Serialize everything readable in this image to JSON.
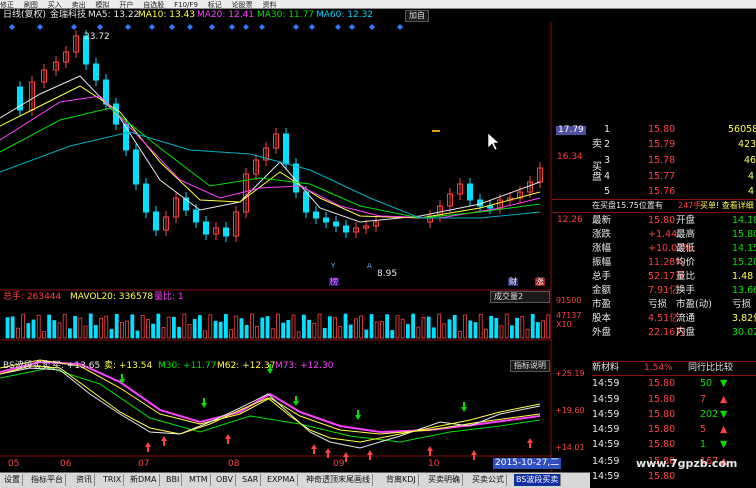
{
  "toolbar": {
    "items": [
      "修正",
      "刷图",
      "买入",
      "卖出",
      "模拟",
      "开户",
      "自选股",
      "F10/F9",
      "标记",
      "论股票",
      "资料"
    ]
  },
  "header": {
    "period": "日线(复权)",
    "stock": "金瑞科技",
    "ma5": "MA5: 13.22",
    "ma10": "MA10: 13.43",
    "ma20": "MA20: 12.41",
    "ma30": "MA30: 11.77",
    "ma60": "MA60: 12.32",
    "add_button": "加自"
  },
  "price_axis": {
    "p1": "17.79",
    "p2": "16.34",
    "p3": "12.26"
  },
  "annotations": {
    "high": "23.72",
    "low": "8.95",
    "hot_mark": "榜",
    "cai": "财",
    "zhang": "涨",
    "y_mark": "Y",
    "a_mark": "A"
  },
  "volume": {
    "label": "总手: 263444",
    "ma20": "MAVOL20: 336578",
    "ratio_label": "量比: 1",
    "dropdown": "成交量2",
    "axis_top": "91500",
    "axis_mid": "47137",
    "axis_unit": "X10"
  },
  "indicator": {
    "name": "BS波段买卖",
    "buy": "买: +13.65",
    "sell": "卖: +13.54",
    "m30": "M30: +11.77",
    "m62": "M62: +12.37",
    "m73": "M73: +12.30",
    "help_button": "指标说明",
    "axis1": "+25.19",
    "axis2": "+19.60",
    "axis3": "+14.01"
  },
  "x_axis": {
    "labels": [
      "05",
      "06",
      "07",
      "08",
      "09",
      "10"
    ],
    "date_badge": "2015-10-27,二"
  },
  "bottom_tabs": [
    "设置",
    "指标平台",
    "资讯",
    "TRIX",
    "新DMA",
    "BBI",
    "MTM",
    "OBV",
    "SAR",
    "EXPMA",
    "神奇透顶末尾画线",
    "背离KDJ",
    "买卖明确",
    "买卖公式",
    "BS波段买卖"
  ],
  "order_book": {
    "top_price": "17.79",
    "sell_side_label": "卖",
    "buy_side_label": "买盘",
    "rows": [
      {
        "idx": "1",
        "price": "15.80",
        "vol": "56058"
      },
      {
        "idx": "2",
        "price": "15.79",
        "vol": "423"
      },
      {
        "idx": "3",
        "price": "15.78",
        "vol": "46"
      },
      {
        "idx": "4",
        "price": "15.77",
        "vol": "4"
      },
      {
        "idx": "5",
        "price": "15.76",
        "vol": "4"
      }
    ]
  },
  "position_line": {
    "text": "在买盘15.75位置有",
    "vol": "247手",
    "action": "买单! 查看详细"
  },
  "quote": {
    "rows": [
      {
        "l1": "最新",
        "v1": "15.80",
        "l2": "开盘",
        "v2": "14.18"
      },
      {
        "l1": "涨跌",
        "v1": "+1.44",
        "l2": "最高",
        "v2": "15.80"
      },
      {
        "l1": "涨幅",
        "v1": "+10.03%",
        "l2": "最低",
        "v2": "14.15"
      },
      {
        "l1": "振幅",
        "v1": "11.28%",
        "l2": "均价",
        "v2": "15.20"
      },
      {
        "l1": "总手",
        "v1": "52.17万",
        "l2": "量比",
        "v2": "1.48"
      },
      {
        "l1": "金额",
        "v1": "7.91亿",
        "l2": "换手",
        "v2": "13.66%"
      },
      {
        "l1": "市盈",
        "v1": "亏损",
        "l2": "市盈(动)",
        "v2": "亏损"
      },
      {
        "l1": "股本",
        "v1": "4.51亿",
        "l2": "流通",
        "v2": "3.82亿"
      },
      {
        "l1": "外盘",
        "v1": "22.16万",
        "l2": "内盘",
        "v2": "30.02万"
      }
    ]
  },
  "ticks": {
    "tab1": "新材料",
    "tab1_pct": "1.54%",
    "tab2": "同行比比较",
    "rows": [
      {
        "time": "14:59",
        "price": "15.80",
        "vol": "50"
      },
      {
        "time": "14:59",
        "price": "15.80",
        "vol": "7"
      },
      {
        "time": "14:59",
        "price": "15.80",
        "vol": "202"
      },
      {
        "time": "14:59",
        "price": "15.80",
        "vol": "5"
      },
      {
        "time": "14:59",
        "price": "15.80",
        "vol": "1"
      },
      {
        "time": "14:59",
        "price": "15.80",
        "vol": "167"
      },
      {
        "time": "14:59",
        "price": "15.80",
        "vol": ""
      }
    ],
    "watermark": "www.7gpzb.com"
  },
  "colors": {
    "up": "#ff4040",
    "down": "#00e0ff",
    "grid": "#8a0f0f"
  }
}
